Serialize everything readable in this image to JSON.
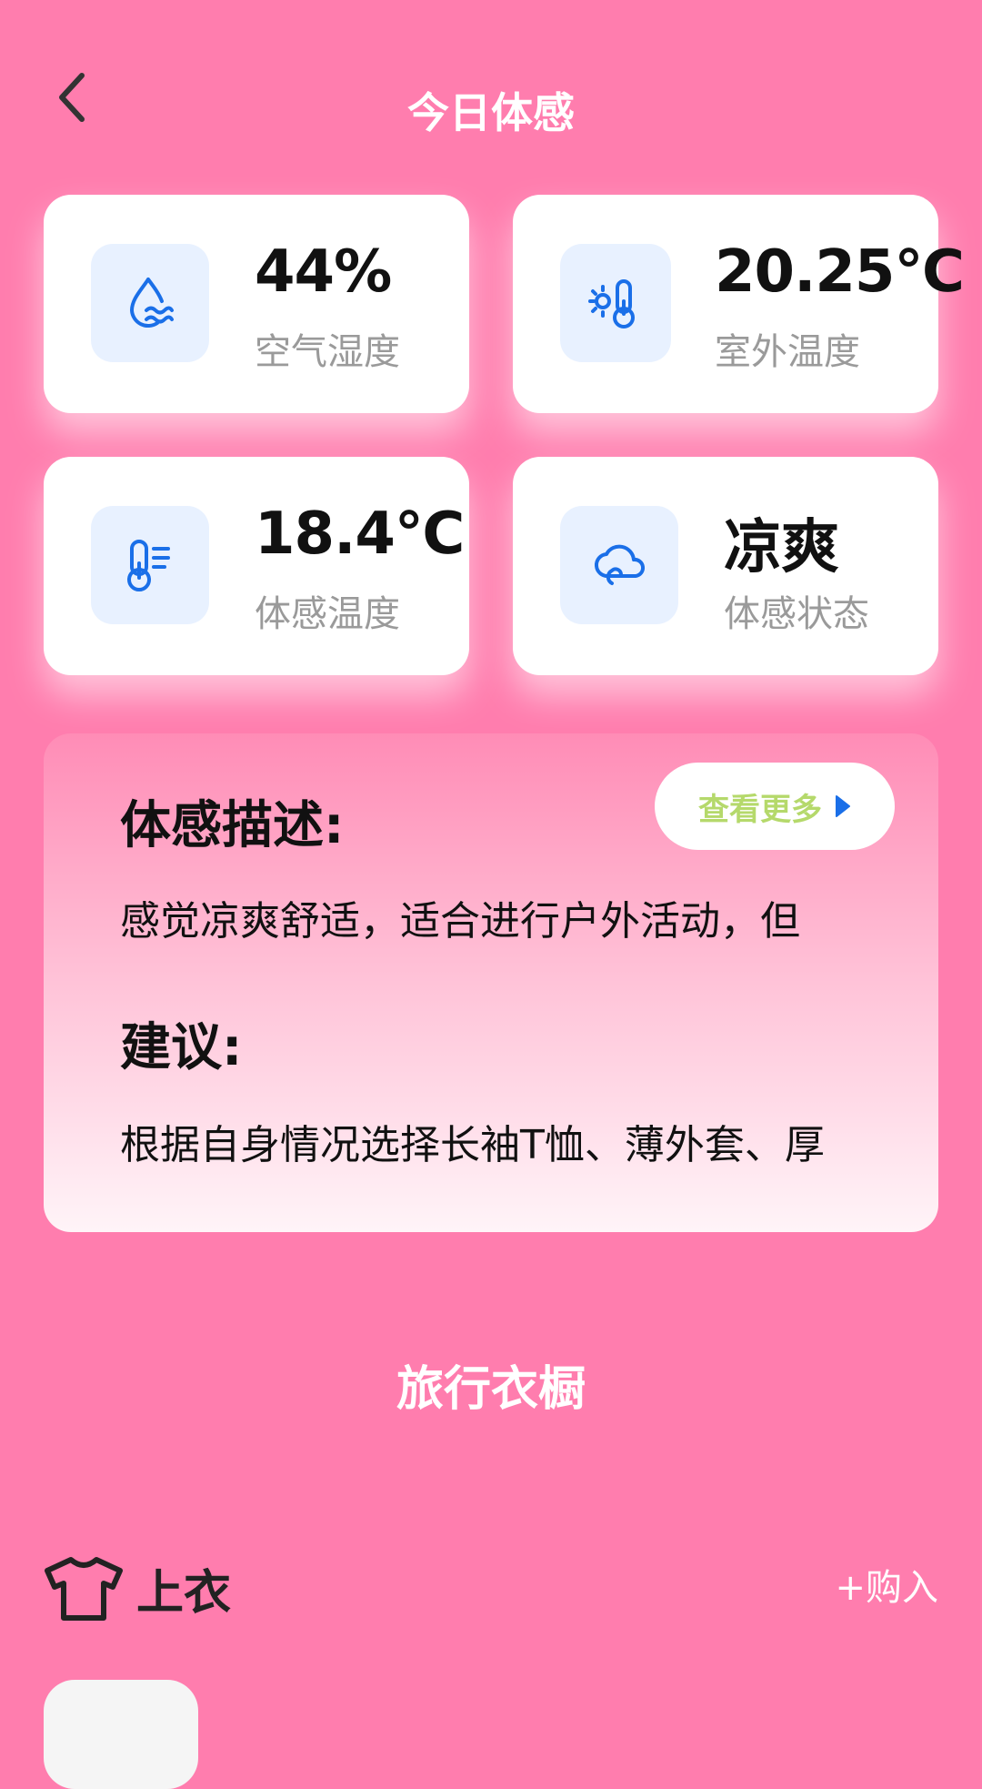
{
  "header": {
    "title": "今日体感"
  },
  "stats": [
    {
      "value": "44%",
      "label": "空气湿度",
      "icon": "humidity-drop-icon"
    },
    {
      "value": "20.25℃",
      "label": "室外温度",
      "icon": "sun-thermometer-icon"
    },
    {
      "value": "18.4℃",
      "label": "体感温度",
      "icon": "thermometer-icon"
    },
    {
      "value": "凉爽",
      "label": "体感状态",
      "icon": "cloud-icon"
    }
  ],
  "panel": {
    "desc_heading": "体感描述:",
    "desc_text": "感觉凉爽舒适，适合进行户外活动，但",
    "advice_heading": "建议:",
    "advice_text": "根据自身情况选择长袖T恤、薄外套、厚",
    "more_label": "查看更多"
  },
  "wardrobe": {
    "title": "旅行衣橱",
    "category": "上衣",
    "buy_label": "+购入"
  },
  "colors": {
    "background": "#FF7DAE",
    "icon_blue": "#1A6FE8",
    "more_text": "#B5D96B"
  }
}
